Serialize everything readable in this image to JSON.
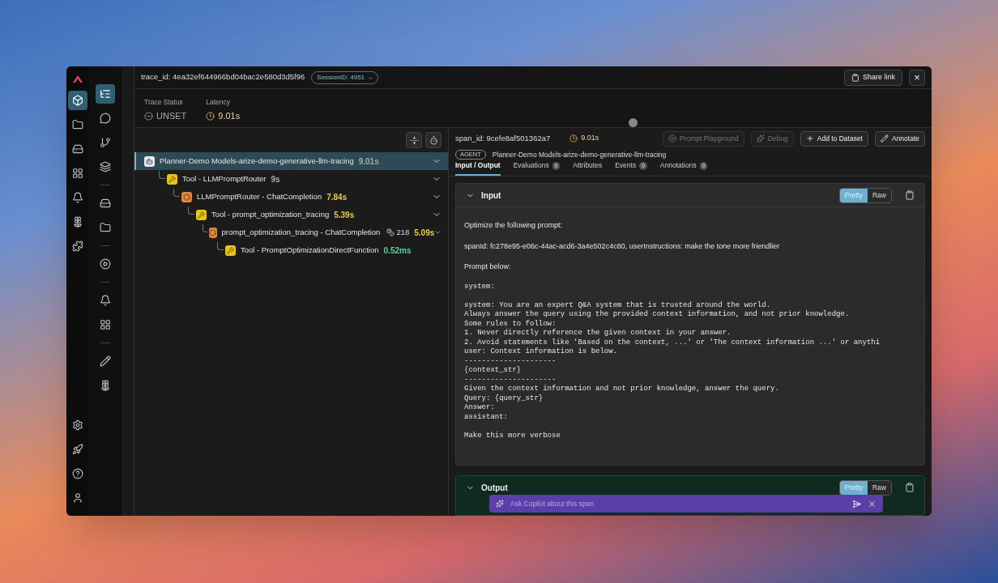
{
  "rail": [
    {
      "selected": true
    },
    {
      "selected": false
    },
    {
      "selected": false
    },
    {
      "selected": false
    },
    {
      "selected": false
    },
    {
      "selected": false
    },
    {
      "selected": false
    }
  ],
  "subrail": [
    {
      "selected": true
    },
    {
      "selected": false
    },
    {
      "selected": false
    },
    {
      "selected": false
    },
    {
      "selected": false
    },
    {
      "selected": false
    },
    {
      "selected": false
    },
    {
      "selected": false
    },
    {
      "selected": false
    },
    {
      "selected": false
    },
    {
      "selected": false
    }
  ],
  "header": {
    "trace_id": "trace_id: 4ea32ef644966bd04bac2e580d3d5f96",
    "session_badge": "SessionID: 4951 →",
    "share": "Share link",
    "close": "×"
  },
  "trace_status": {
    "label": "Trace Status",
    "value": "UNSET"
  },
  "latency": {
    "label": "Latency",
    "value": "9.01s"
  },
  "tree": [
    {
      "kind": "agent",
      "name": "Planner-Demo Models-arize-demo-generative-llm-tracing",
      "duration": "9.01s",
      "color": "#a8a8a0",
      "selected": true,
      "expanded": true,
      "children": [
        {
          "kind": "tool",
          "name": "Tool - LLMPromptRouter",
          "duration": "9s",
          "color": "#a8a8a0",
          "selected": false,
          "expanded": true,
          "children": [
            {
              "kind": "llm",
              "name": "LLMPromptRouter - ChatCompletion",
              "duration": "7.84s",
              "color": "#e6c84a",
              "selected": false,
              "expanded": true,
              "children": [
                {
                  "kind": "tool",
                  "name": "Tool - prompt_optimization_tracing",
                  "duration": "5.39s",
                  "color": "#e6c84a",
                  "selected": false,
                  "expanded": true,
                  "children": [
                    {
                      "kind": "llm",
                      "name": "prompt_optimization_tracing - ChatCompletion",
                      "tokens": "218",
                      "duration": "5.09s",
                      "color": "#e6c84a",
                      "selected": false,
                      "expanded": true,
                      "children": [
                        {
                          "kind": "tool",
                          "name": "Tool - PromptOptimizationDirectFunction",
                          "duration": "0.52ms",
                          "color": "#5fcf9a",
                          "selected": false
                        }
                      ]
                    }
                  ]
                }
              ]
            }
          ]
        }
      ]
    }
  ],
  "span": {
    "id": "span_id: 9cefe8af501362a7",
    "duration": "9.01s",
    "kind_badge": "AGENT",
    "name": "Planner-Demo Models-arize-demo-generative-llm-tracing",
    "actions": [
      {
        "kind": "play",
        "label": "Prompt Playground",
        "disabled": true
      },
      {
        "kind": "sparkle",
        "label": "Debug",
        "disabled": true
      },
      {
        "kind": "plus",
        "label": "Add to Dataset",
        "disabled": false
      },
      {
        "kind": "pencil",
        "label": "Annotate",
        "disabled": false
      }
    ]
  },
  "tabs": [
    {
      "label": "Input / Output",
      "selected": true
    },
    {
      "label": "Evaluations",
      "count": "0",
      "selected": false
    },
    {
      "label": "Attributes",
      "selected": false
    },
    {
      "label": "Events",
      "count": "0",
      "selected": false
    },
    {
      "label": "Annotations",
      "count": "0",
      "selected": false
    }
  ],
  "input": {
    "title": "Input",
    "expanded": true,
    "modes": [
      {
        "label": "Pretty",
        "selected": true
      },
      {
        "label": "Raw",
        "selected": false
      }
    ],
    "paragraphs": [
      "Optimize the following prompt:",
      "spanId: fc278e95-e06c-44ac-acd6-3a4e502c4c80, userInstructions: make the tone more friendlier",
      "Prompt below:"
    ],
    "code": "system:\n\nsystem: You are an expert Q&A system that is trusted around the world.\nAlways answer the query using the provided context information, and not prior knowledge.\nSome rules to follow:\n1. Never directly reference the given context in your answer.\n2. Avoid statements like 'Based on the context, ...' or 'The context information ...' or anythi\nuser: Context information is below.\n---------------------\n{context_str}\n---------------------\nGiven the context information and not prior knowledge, answer the query.\nQuery: {query_str}\nAnswer:\nassistant:\n\nMake this more verbose"
  },
  "output": {
    "title": "Output",
    "expanded": true,
    "modes": [
      {
        "label": "Pretty",
        "selected": true
      },
      {
        "label": "Raw",
        "selected": false
      }
    ]
  },
  "copilot": {
    "placeholder": "Ask Copilot about this span"
  }
}
